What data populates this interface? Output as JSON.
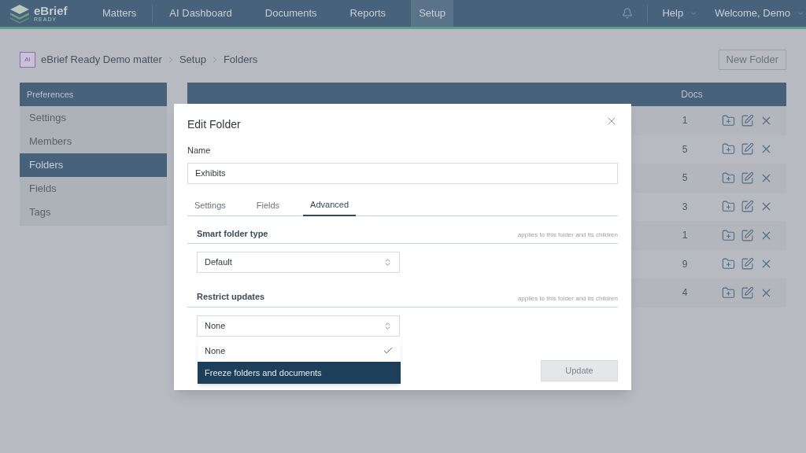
{
  "nav": {
    "logo": {
      "name": "eBrief",
      "sub": "READY"
    },
    "items": [
      {
        "label": "Matters",
        "selected": false
      },
      {
        "label": "AI Dashboard",
        "selected": false
      },
      {
        "label": "Documents",
        "selected": false
      },
      {
        "label": "Reports",
        "selected": false
      },
      {
        "label": "Setup",
        "selected": true
      }
    ],
    "help": "Help",
    "user": "Welcome, Demo"
  },
  "breadcrumb": {
    "badge": "AI",
    "items": [
      "eBrief Ready Demo matter",
      "Setup",
      "Folders"
    ]
  },
  "new_folder": "New Folder",
  "sidebar": {
    "title": "Preferences",
    "items": [
      {
        "label": "Settings",
        "selected": false
      },
      {
        "label": "Members",
        "selected": false
      },
      {
        "label": "Folders",
        "selected": true
      },
      {
        "label": "Fields",
        "selected": false
      },
      {
        "label": "Tags",
        "selected": false
      }
    ]
  },
  "table": {
    "columns": [
      "Docs"
    ],
    "rows": [
      {
        "docs": "1"
      },
      {
        "docs": "5"
      },
      {
        "docs": "5"
      },
      {
        "docs": "3"
      },
      {
        "docs": "1"
      },
      {
        "docs": "9"
      },
      {
        "docs": "4"
      }
    ]
  },
  "modal": {
    "title": "Edit Folder",
    "name_label": "Name",
    "name_value": "Exhibits",
    "tabs": [
      {
        "label": "Settings",
        "selected": false
      },
      {
        "label": "Fields",
        "selected": false
      },
      {
        "label": "Advanced",
        "selected": true
      }
    ],
    "sections": [
      {
        "title": "Smart folder type",
        "hint": "applies to this folder and its children",
        "value": "Default"
      },
      {
        "title": "Restrict updates",
        "hint": "applies to this folder and its children",
        "value": "None"
      }
    ],
    "options": [
      {
        "label": "None",
        "checked": true,
        "selected": false
      },
      {
        "label": "Freeze folders and documents",
        "checked": false,
        "selected": true
      }
    ],
    "update": "Update"
  }
}
